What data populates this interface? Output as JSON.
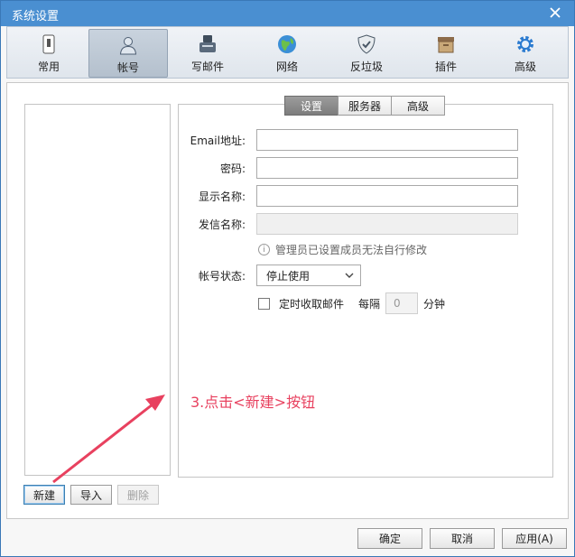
{
  "window": {
    "title": "系统设置"
  },
  "toolbar": {
    "items": [
      {
        "label": "常用",
        "icon": "phone-icon"
      },
      {
        "label": "帐号",
        "icon": "user-icon",
        "active": true
      },
      {
        "label": "写邮件",
        "icon": "compose-icon"
      },
      {
        "label": "网络",
        "icon": "globe-icon"
      },
      {
        "label": "反垃圾",
        "icon": "shield-icon"
      },
      {
        "label": "插件",
        "icon": "box-icon"
      },
      {
        "label": "高级",
        "icon": "gear-icon"
      }
    ]
  },
  "account_list": {
    "buttons": {
      "new": "新建",
      "import": "导入",
      "delete": "删除"
    }
  },
  "tabs": {
    "settings": "设置",
    "server": "服务器",
    "advanced": "高级"
  },
  "form": {
    "email_label": "Email地址:",
    "email_value": "",
    "password_label": "密码:",
    "password_value": "",
    "display_name_label": "显示名称:",
    "display_name_value": "",
    "sender_name_label": "发信名称:",
    "sender_name_value": "",
    "notice": "管理员已设置成员无法自行修改",
    "status_label": "帐号状态:",
    "status_value": "停止使用",
    "timer_label": "定时收取邮件",
    "every_label": "每隔",
    "interval_value": "0",
    "minute_label": "分钟"
  },
  "annotation": {
    "text": "3.点击<新建>按钮",
    "color": "#e8415f"
  },
  "footer": {
    "ok": "确定",
    "cancel": "取消",
    "apply": "应用(A)"
  }
}
